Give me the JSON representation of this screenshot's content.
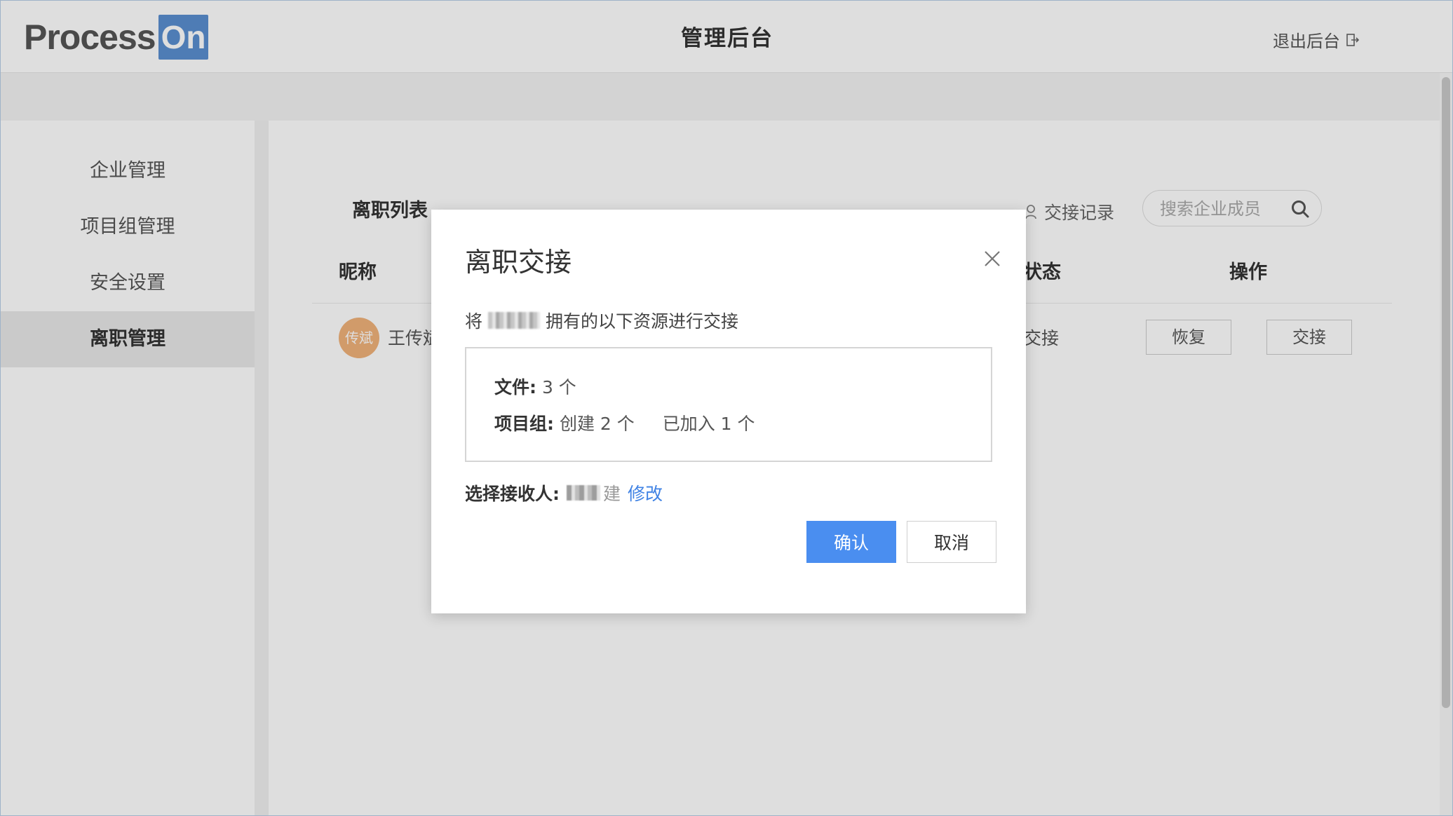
{
  "header": {
    "logo_word": "Process",
    "logo_badge": "On",
    "title": "管理后台",
    "logout_label": "退出后台"
  },
  "sidebar": {
    "items": [
      {
        "label": "企业管理",
        "active": false
      },
      {
        "label": "项目组管理",
        "active": false
      },
      {
        "label": "安全设置",
        "active": false
      },
      {
        "label": "离职管理",
        "active": true
      }
    ]
  },
  "main": {
    "list_title": "离职列表",
    "records_label": "交接记录",
    "search_placeholder": "搜索企业成员",
    "columns": [
      "昵称",
      "状态",
      "操作"
    ],
    "rows": [
      {
        "avatar_text": "传斌",
        "name": "王传斌",
        "status": "交接",
        "actions": [
          "恢复",
          "交接"
        ]
      }
    ]
  },
  "modal": {
    "title": "离职交接",
    "desc_prefix": "将",
    "desc_suffix": "拥有的以下资源进行交接",
    "files_label": "文件:",
    "files_value": "3 个",
    "groups_label": "项目组:",
    "groups_created": "创建 2 个",
    "groups_joined": "已加入 1 个",
    "receiver_label": "选择接收人:",
    "receiver_tail": "建",
    "modify_label": "修改",
    "confirm_label": "确认",
    "cancel_label": "取消"
  },
  "colors": {
    "accent": "#4a8ef0",
    "link": "#3f82e4",
    "avatar": "#f0b27a",
    "logo_badge": "#5a8fd0"
  }
}
